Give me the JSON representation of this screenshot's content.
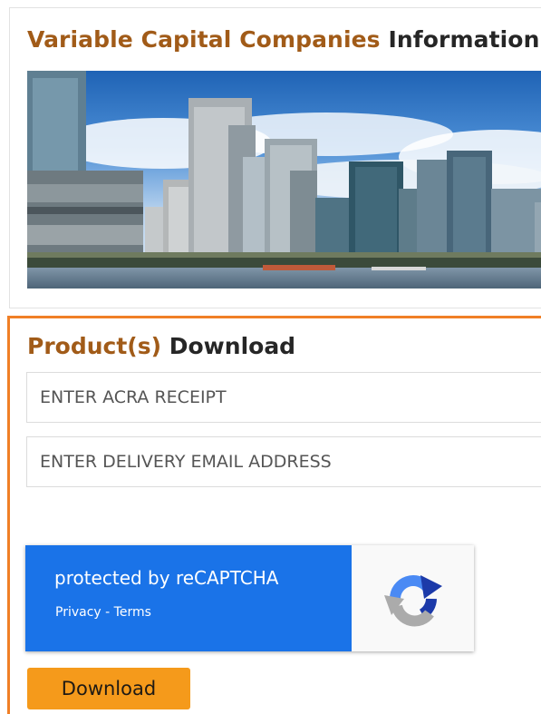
{
  "header": {
    "title_accent": "Variable Capital Companies",
    "title_rest": "Information"
  },
  "banner": {
    "image": "singapore-skyline-image"
  },
  "download_section": {
    "title_accent": "Product(s)",
    "title_rest": "Download",
    "receipt_placeholder": "ENTER ACRA RECEIPT",
    "email_placeholder": "ENTER DELIVERY EMAIL ADDRESS",
    "button_label": "Download"
  },
  "recaptcha": {
    "protected_text": "protected by reCAPTCHA",
    "privacy_label": "Privacy",
    "separator": " - ",
    "terms_label": "Terms",
    "icon": "recaptcha-logo-icon"
  },
  "colors": {
    "accent_text": "#a15b18",
    "section_border": "#f07f26",
    "button": "#f59a1b",
    "recaptcha_blue": "#1a73e8"
  }
}
